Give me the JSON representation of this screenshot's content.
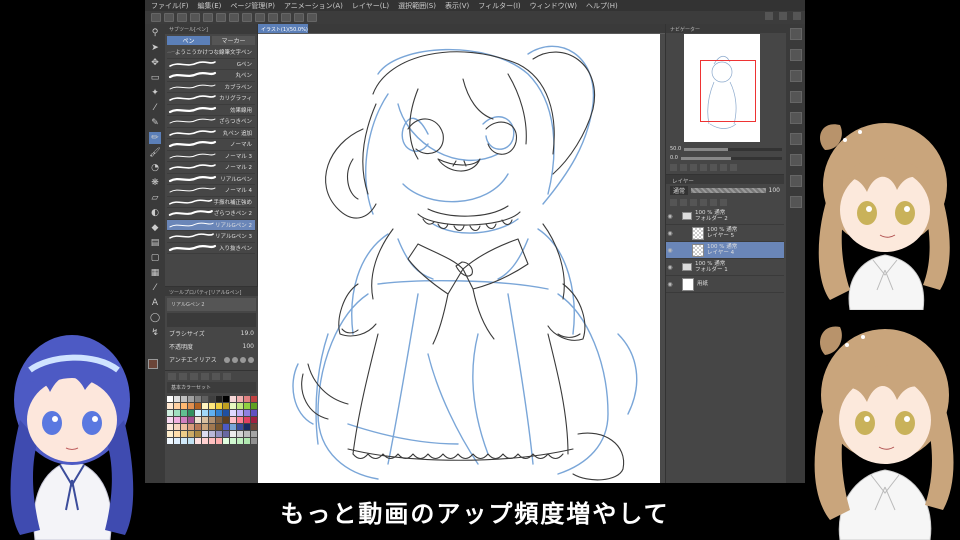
{
  "menu": [
    "ファイル(F)",
    "編集(E)",
    "ページ管理(P)",
    "アニメーション(A)",
    "レイヤー(L)",
    "選択範囲(S)",
    "表示(V)",
    "フィルター(I)",
    "ウィンドウ(W)",
    "ヘルプ(H)"
  ],
  "subtool": {
    "header": "サブツール[ペン]",
    "tabs": [
      {
        "label": "ペン"
      },
      {
        "label": "マーカー"
      }
    ],
    "brushes": [
      {
        "name": "ようこうかけつな線筆文字ペン",
        "active": false
      },
      {
        "name": "Gペン",
        "active": false
      },
      {
        "name": "丸ペン",
        "active": false
      },
      {
        "name": "カブラペン",
        "active": false
      },
      {
        "name": "カリグラフィ",
        "active": false
      },
      {
        "name": "効果線用",
        "active": false
      },
      {
        "name": "ざらつきペン",
        "active": false
      },
      {
        "name": "丸ペン 追加",
        "active": false
      },
      {
        "name": "ノーマル",
        "active": false
      },
      {
        "name": "ノーマル 3",
        "active": false
      },
      {
        "name": "ノーマル 2",
        "active": false
      },
      {
        "name": "リアルGペン",
        "active": false
      },
      {
        "name": "ノーマル 4",
        "active": false
      },
      {
        "name": "手振れ補正強め",
        "active": false
      },
      {
        "name": "ざらつきペン 2",
        "active": false
      },
      {
        "name": "リアルGペン 2",
        "active": true
      },
      {
        "name": "リアルGペン 3",
        "active": false
      },
      {
        "name": "入り抜きペン",
        "active": false
      }
    ]
  },
  "toolprop": {
    "header": "ツールプロパティ[リアルGペン]",
    "name": "リアルGペン 2",
    "brush_size_label": "ブラシサイズ",
    "brush_size_value": "19.0",
    "opacity_label": "不透明度",
    "opacity_value": "100",
    "aa_label": "アンチエイリアス"
  },
  "colorset": {
    "header": "基本カラーセット"
  },
  "canvas": {
    "tab_label": "イラスト(1)(50.0%)"
  },
  "navigator": {
    "header": "ナビゲーター",
    "zoom": "50.0",
    "rotate": "0.0"
  },
  "layers": {
    "header": "レイヤー",
    "blend": "通常",
    "opacity": "100",
    "items": [
      {
        "line1": "100 % 通常",
        "line2": "フォルダー 2",
        "type": "folder",
        "selected": false
      },
      {
        "line1": "100 % 通常",
        "line2": "レイヤー 5",
        "type": "raster",
        "selected": false
      },
      {
        "line1": "100 % 通常",
        "line2": "レイヤー 4",
        "type": "raster",
        "selected": true
      },
      {
        "line1": "100 % 通常",
        "line2": "フォルダー 1",
        "type": "folder",
        "selected": false
      },
      {
        "line1": "",
        "line2": "用紙",
        "type": "paper",
        "selected": false
      }
    ]
  },
  "subtitle": "もっと動画のアップ頻度増やして",
  "colors": {
    "accent": "#5b7fb8",
    "main_color": "#6b4538",
    "blue_sketch": "#7aa6d8",
    "line": "#333333"
  }
}
